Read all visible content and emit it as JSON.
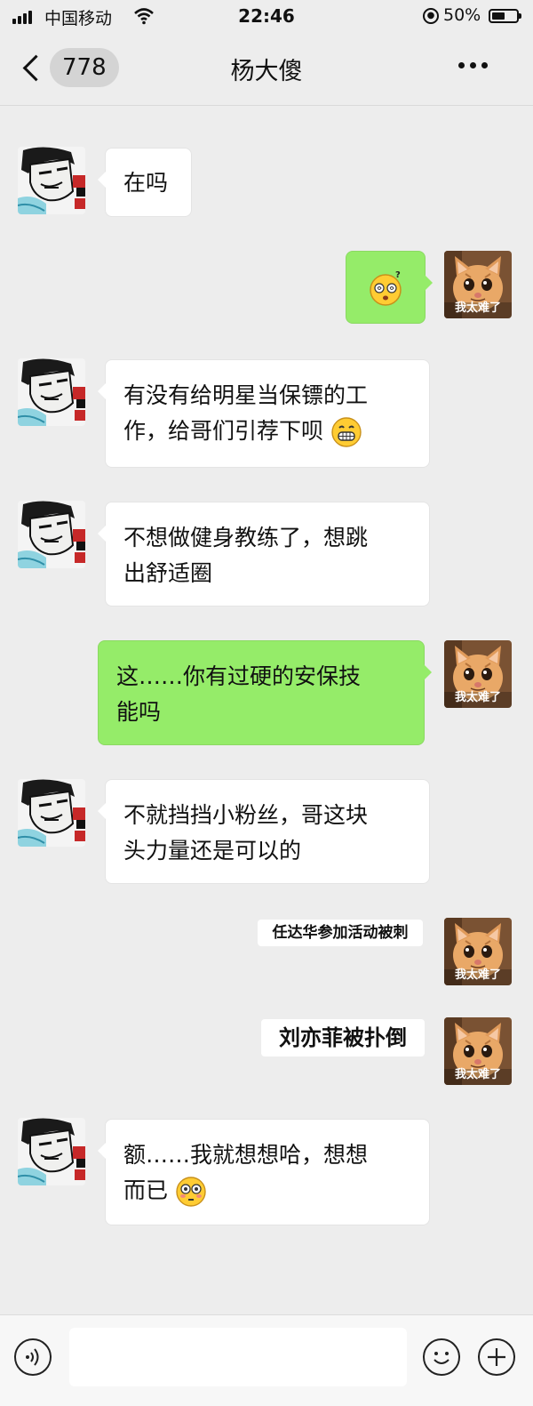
{
  "status_bar": {
    "carrier": "中国移动",
    "time": "22:46",
    "battery": "50%",
    "battery_level": 0.5
  },
  "nav": {
    "unread_count": "778",
    "title": "杨大傻"
  },
  "sticker_caption": "我太难了",
  "messages": [
    {
      "side": "left",
      "text": "在吗"
    },
    {
      "side": "right",
      "emoji": "dizzy-face-emoji"
    },
    {
      "side": "left",
      "line1": "有没有给明星当保镖的工",
      "line2": "作，给哥们引荐下呗",
      "emoji": "grinning-face-emoji"
    },
    {
      "side": "left",
      "line1": "不想做健身教练了，想跳",
      "line2": "出舒适圈"
    },
    {
      "side": "right",
      "line1": "这……你有过硬的安保技",
      "line2": "能吗"
    },
    {
      "side": "left",
      "line1": "不就挡挡小粉丝，哥这块",
      "line2": "头力量还是可以的"
    },
    {
      "side": "right",
      "sticker_text": "任达华参加活动被刺"
    },
    {
      "side": "right",
      "sticker_text": "刘亦菲被扑倒"
    },
    {
      "side": "left",
      "line1": "额……我就想想哈，想想",
      "line2": "而已",
      "emoji": "flushed-face-emoji"
    }
  ],
  "colors": {
    "background": "#ededed",
    "green_bubble": "#95ec69",
    "white_bubble": "#ffffff"
  },
  "input": {
    "placeholder": ""
  }
}
